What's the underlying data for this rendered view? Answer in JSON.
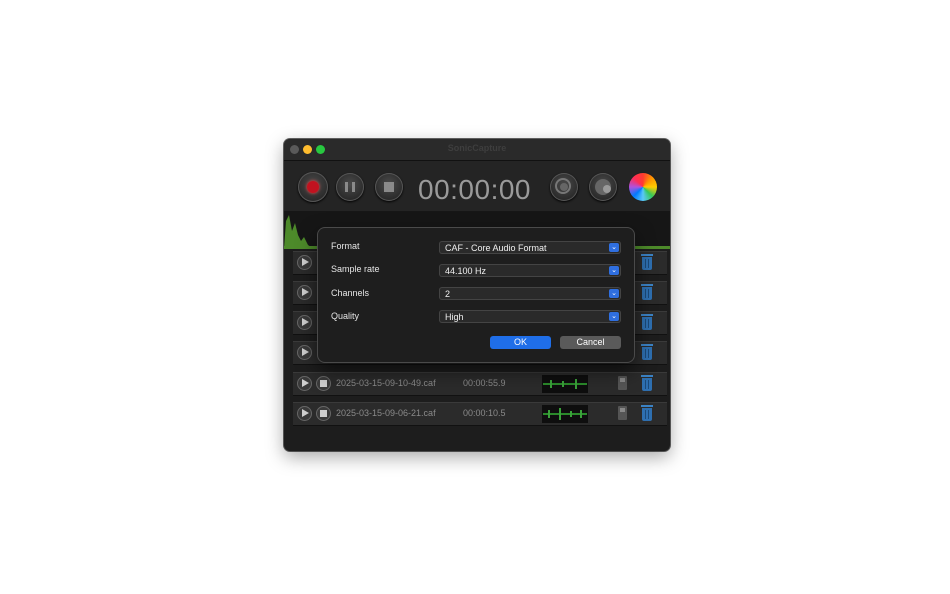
{
  "window": {
    "title": "SonicCapture"
  },
  "toolbar": {
    "timer": "00:00:00"
  },
  "recordings": [
    {
      "filename": "",
      "duration": ""
    },
    {
      "filename": "",
      "duration": ""
    },
    {
      "filename": "",
      "duration": ""
    },
    {
      "filename": "",
      "duration": ""
    },
    {
      "filename": "2025-03-15-09-10-49.caf",
      "duration": "00:00:55.9"
    },
    {
      "filename": "2025-03-15-09-06-21.caf",
      "duration": "00:00:10.5"
    }
  ],
  "dialog": {
    "fields": [
      {
        "label": "Format",
        "value": "CAF - Core Audio Format"
      },
      {
        "label": "Sample rate",
        "value": "44.100 Hz"
      },
      {
        "label": "Channels",
        "value": "2"
      },
      {
        "label": "Quality",
        "value": "High"
      }
    ],
    "ok_label": "OK",
    "cancel_label": "Cancel"
  },
  "colors": {
    "accent": "#1f6ee8",
    "record": "#c1121f",
    "meter": "#4d8a2a",
    "trash": "#2e6fb0"
  },
  "icons": [
    "record-icon",
    "pause-icon",
    "stop-icon",
    "speaker-icon",
    "microphone-icon",
    "color-wheel-icon",
    "play-icon",
    "save-icon",
    "trash-icon",
    "chevron-down-icon"
  ]
}
